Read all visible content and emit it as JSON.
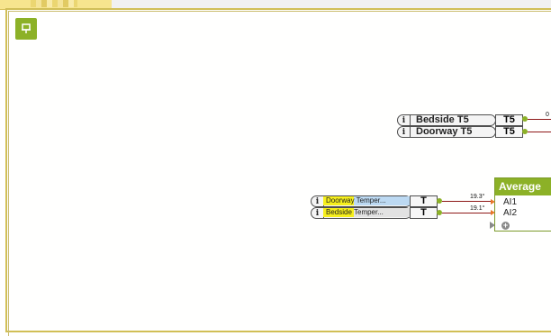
{
  "canvas": {
    "pin_icon": "pin-icon"
  },
  "outputs": [
    {
      "name": "Bedside T5",
      "tag": "T5",
      "wire_value": "0"
    },
    {
      "name": "Doorway T5",
      "tag": "T5"
    }
  ],
  "inputs": [
    {
      "name": "Doorway Temper...",
      "tag": "T",
      "wire_value": "19.3°"
    },
    {
      "name": "Bedside Temper...",
      "tag": "T",
      "wire_value": "19.1°"
    }
  ],
  "average_block": {
    "title": "Average",
    "inputs": [
      "AI1",
      "AI2"
    ],
    "add_icon": "plus-icon"
  },
  "colors": {
    "accent_green": "#8cb127",
    "wire": "#8e1818",
    "input_highlight_blue": "#bcd9f2",
    "input_highlight_yellow": "#f6ef1c"
  }
}
